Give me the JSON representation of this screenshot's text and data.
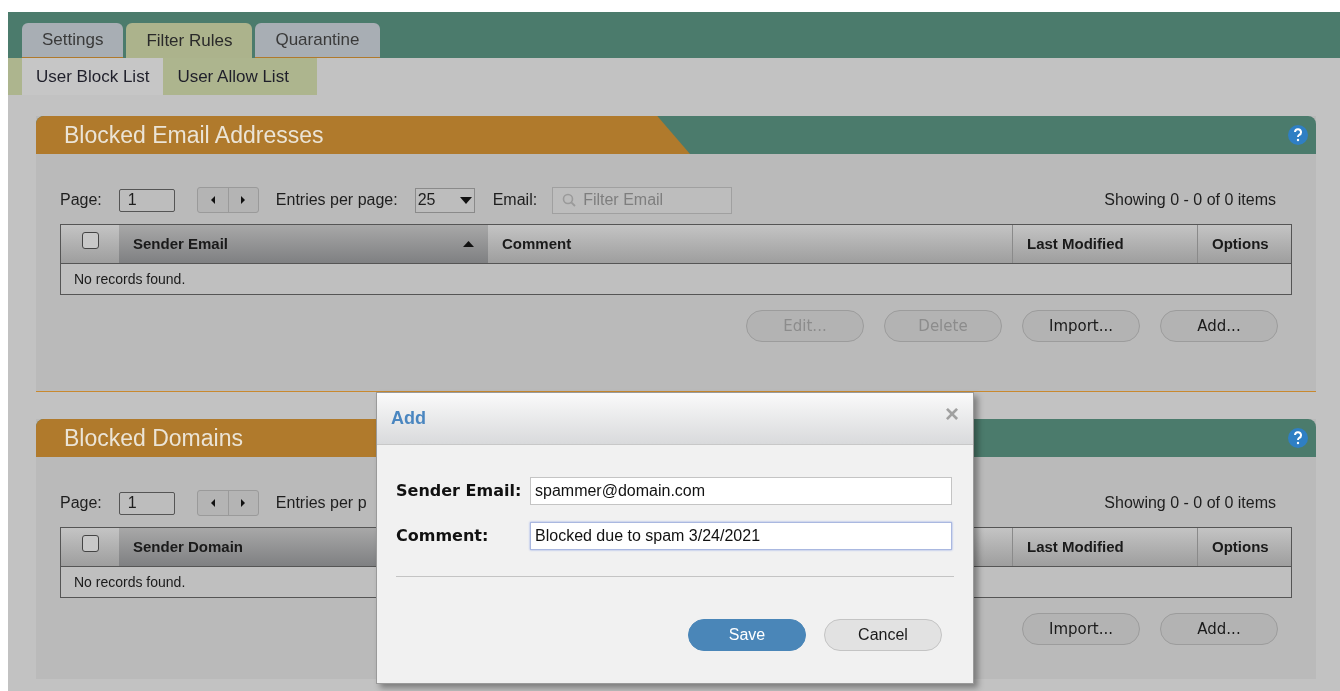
{
  "tabs": [
    {
      "label": "Settings",
      "selected": false
    },
    {
      "label": "Filter Rules",
      "selected": true
    },
    {
      "label": "Quarantine",
      "selected": false
    }
  ],
  "subtabs": [
    {
      "label": "User Block List",
      "selected": true
    },
    {
      "label": "User Allow List",
      "selected": false
    }
  ],
  "panels": [
    {
      "title": "Blocked Email Addresses",
      "toolbar": {
        "page_label": "Page:",
        "page_value": "1",
        "entries_label": "Entries per page:",
        "entries_value": "25",
        "filter_label": "Email:",
        "filter_placeholder": "Filter Email",
        "showing": "Showing 0 - 0 of 0 items"
      },
      "table": {
        "header_checked": false,
        "columns": [
          {
            "kind": "main",
            "label": "Sender Email",
            "sorted": true
          },
          {
            "kind": "comment",
            "label": "Comment",
            "sorted": false
          },
          {
            "kind": "date",
            "label": "Last Modified",
            "sorted": false
          },
          {
            "kind": "options",
            "label": "Options",
            "sorted": false
          }
        ],
        "empty_text": "No records found."
      },
      "buttons": [
        {
          "label": "Edit...",
          "disabled": true
        },
        {
          "label": "Delete",
          "disabled": true
        },
        {
          "label": "Import...",
          "disabled": false
        },
        {
          "label": "Add...",
          "disabled": false
        }
      ]
    },
    {
      "title": "Blocked Domains",
      "toolbar": {
        "page_label": "Page:",
        "page_value": "1",
        "entries_label": "Entries per p",
        "showing": "Showing 0 - 0 of 0 items"
      },
      "table": {
        "header_checked": false,
        "columns": [
          {
            "kind": "main",
            "label": "Sender Domain"
          },
          {
            "kind": "comment"
          },
          {
            "kind": "date",
            "label": "Last Modified"
          },
          {
            "kind": "options",
            "label": "Options"
          }
        ],
        "empty_text": "No records found."
      },
      "buttons": [
        {
          "label": "Import...",
          "disabled": false
        },
        {
          "label": "Add...",
          "disabled": false
        }
      ]
    }
  ],
  "dialog": {
    "title": "Add",
    "close": "×",
    "fields": [
      {
        "label": "Sender Email:",
        "value": "spammer@domain.com",
        "focused": false
      },
      {
        "label": "Comment:",
        "value": "Blocked due to spam 3/24/2021",
        "focused": true
      }
    ],
    "buttons": [
      {
        "label": "Save",
        "kind": "primary"
      },
      {
        "label": "Cancel",
        "kind": "secondary"
      }
    ]
  }
}
